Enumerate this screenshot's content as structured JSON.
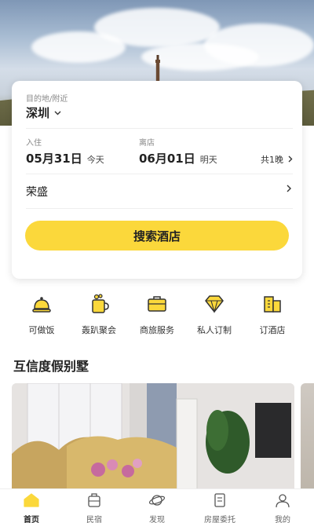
{
  "card": {
    "destination_label": "目的地/附近",
    "destination_value": "深圳",
    "checkin_label": "入住",
    "checkin_date": "05月31日",
    "checkin_day": "今天",
    "checkout_label": "离店",
    "checkout_date": "06月01日",
    "checkout_day": "明天",
    "nights": "共1晚",
    "keyword": "荣盛",
    "search_button": "搜索酒店"
  },
  "services": [
    {
      "label": "可做饭",
      "icon": "cloche-icon"
    },
    {
      "label": "轰趴聚会",
      "icon": "party-cup-icon"
    },
    {
      "label": "商旅服务",
      "icon": "briefcase-icon"
    },
    {
      "label": "私人订制",
      "icon": "diamond-icon"
    },
    {
      "label": "订酒店",
      "icon": "building-icon"
    }
  ],
  "section_title": "互信度假别墅",
  "tabs": [
    {
      "label": "首页",
      "icon": "home-icon",
      "active": true
    },
    {
      "label": "民宿",
      "icon": "luggage-icon",
      "active": false
    },
    {
      "label": "发现",
      "icon": "planet-icon",
      "active": false
    },
    {
      "label": "房屋委托",
      "icon": "document-icon",
      "active": false
    },
    {
      "label": "我的",
      "icon": "user-icon",
      "active": false
    }
  ],
  "colors": {
    "accent": "#fbd83b",
    "icon_outline": "#333333"
  }
}
